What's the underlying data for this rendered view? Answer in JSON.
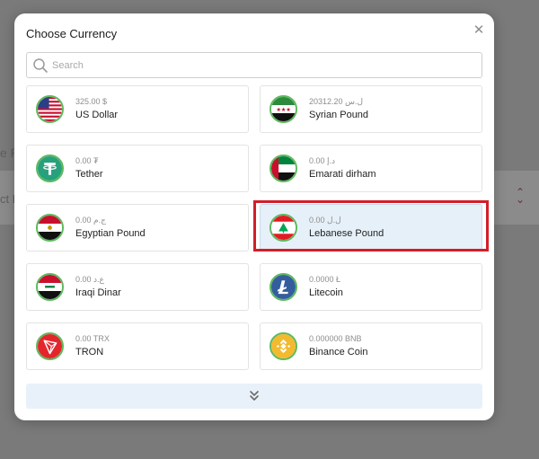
{
  "dialog": {
    "title": "Choose Currency",
    "close_icon": "close-icon",
    "search": {
      "placeholder": "Search",
      "value": ""
    }
  },
  "currencies": [
    {
      "amount": "325.00 $",
      "name": "US Dollar",
      "icon": "us-flag-icon"
    },
    {
      "amount": "20312.20 ل.س",
      "name": "Syrian Pound",
      "icon": "syria-flag-icon"
    },
    {
      "amount": "0.00 ₮",
      "name": "Tether",
      "icon": "tether-icon"
    },
    {
      "amount": "0.00 د.إ",
      "name": "Emarati dirham",
      "icon": "uae-flag-icon"
    },
    {
      "amount": "0.00 ج.م",
      "name": "Egyptian Pound",
      "icon": "egypt-flag-icon"
    },
    {
      "amount": "0.00 ل.ل",
      "name": "Lebanese Pound",
      "icon": "lebanon-flag-icon",
      "selected": true
    },
    {
      "amount": "0.00 ع.د",
      "name": "Iraqi Dinar",
      "icon": "iraq-flag-icon"
    },
    {
      "amount": "0.0000 Ł",
      "name": "Litecoin",
      "icon": "litecoin-icon"
    },
    {
      "amount": "0.00 TRX",
      "name": "TRON",
      "icon": "tron-icon"
    },
    {
      "amount": "0.000000 BNB",
      "name": "Binance Coin",
      "icon": "binance-icon"
    }
  ],
  "load_more_icon": "double-chevron-down-icon",
  "colors": {
    "selected_bg": "#e6f0f9",
    "highlight_outline": "#d21f28",
    "icon_ring": "#5fb85f",
    "load_more_bg": "#e8f1f9"
  }
}
